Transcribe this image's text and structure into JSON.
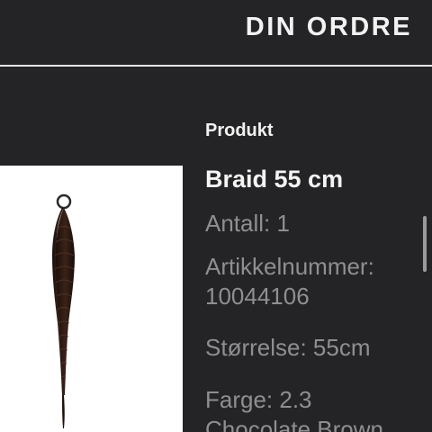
{
  "header": {
    "title": "DIN ORDRE"
  },
  "product_section": {
    "heading": "Produkt",
    "image_icon": "braid-hair-extension-image",
    "name": "Braid 55 cm",
    "quantity": "Antall: 1",
    "article_label": "Artikkelnummer:",
    "article_number": "10044106",
    "size": "Størrelse: 55cm",
    "color_label": "Farge: 2.3",
    "color_name": "Chocolate Brown"
  },
  "colors": {
    "background": "#242426",
    "divider": "#e6e6e6",
    "heading_text": "#f2f2f2",
    "detail_text": "#8f8f91"
  }
}
